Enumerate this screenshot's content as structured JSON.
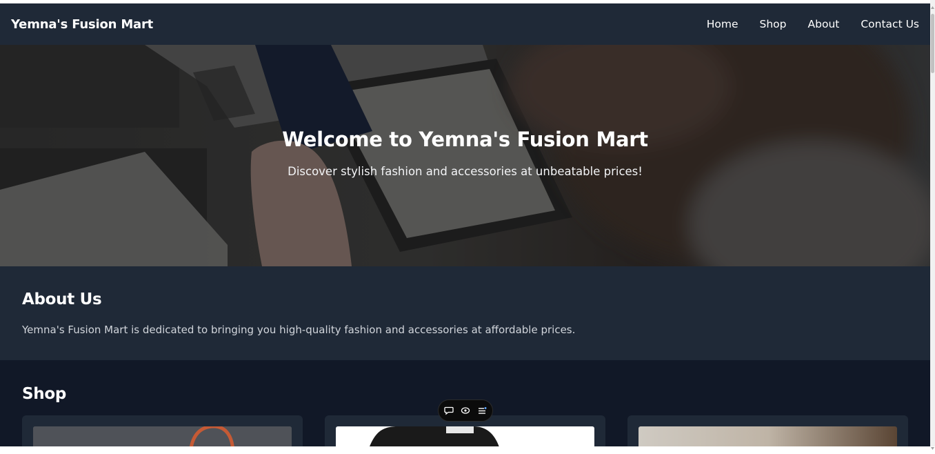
{
  "header": {
    "brand": "Yemna's Fusion Mart",
    "nav": [
      "Home",
      "Shop",
      "About",
      "Contact Us"
    ]
  },
  "hero": {
    "title": "Welcome to Yemna's Fusion Mart",
    "subtitle": "Discover stylish fashion and accessories at unbeatable prices!"
  },
  "about": {
    "heading": "About Us",
    "text": "Yemna's Fusion Mart is dedicated to bringing you high-quality fashion and accessories at affordable prices."
  },
  "shop": {
    "heading": "Shop"
  },
  "toolbar": {
    "icons": [
      "chat-icon",
      "eye-icon",
      "list-icon"
    ]
  },
  "colors": {
    "header_bg": "#1f2937",
    "section_dark": "#111827",
    "text_light": "#d1d5db"
  }
}
